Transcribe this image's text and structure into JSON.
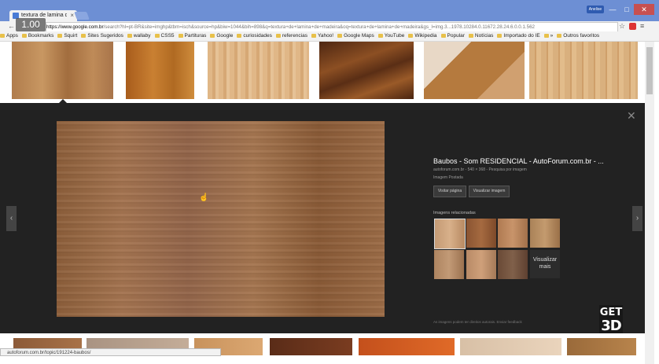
{
  "browser": {
    "tab_title": "textura de lamina de...",
    "tab_close": "×",
    "user_badge": "Anelise",
    "min": "—",
    "max": "□",
    "close": "✕",
    "back": "←",
    "reload": "C",
    "url_host": "https://www.google.com.br",
    "url_rest": "/search?hl=pt-BR&site=imghp&tbm=isch&source=hp&biw=1044&bih=898&q=textura+de+lamina+de+madeira&oq=textura+de+lamina+de+madeira&gs_l=img.3...1978.10284.0.11672.28.24.6.0.0.1.562",
    "star": "☆",
    "menu": "≡",
    "zoom": "1.00"
  },
  "bookmarks": [
    "Apps",
    "Bookmarks",
    "Squirt",
    "Sites Sugeridos",
    "wallaby",
    "CSS5",
    "Partituras",
    "Google",
    "curiosidades",
    "referencias",
    "Yahoo!",
    "Google Maps",
    "YouTube",
    "Wikipedia",
    "Popular",
    "Notícias",
    "Importado do IE",
    "»",
    "Outros favoritos"
  ],
  "preview": {
    "title": "Baubos - Som RESIDENCIAL - AutoForum.com.br - ...",
    "meta": "autoforum.com.br  -  540 × 368  -  Pesquisa por imagem",
    "sub": "Imagem Postada",
    "visit_button": "Visitar página",
    "view_button": "Visualizar imagem",
    "related_title": "Imagens relacionadas",
    "see_more": "Visualizar mais",
    "footer_note": "As imagens podem ter direitos autorais.  Enviar feedback",
    "close": "✕",
    "prev": "‹",
    "next": "›"
  },
  "watermark": {
    "line1": "GET",
    "line2": "3D"
  },
  "status_bar": "autoforum.com.br/topic/191224-baubos/",
  "colors": {
    "titlebar": "#6d8fd4",
    "preview_bg": "#222222",
    "close_button": "#c75050"
  }
}
